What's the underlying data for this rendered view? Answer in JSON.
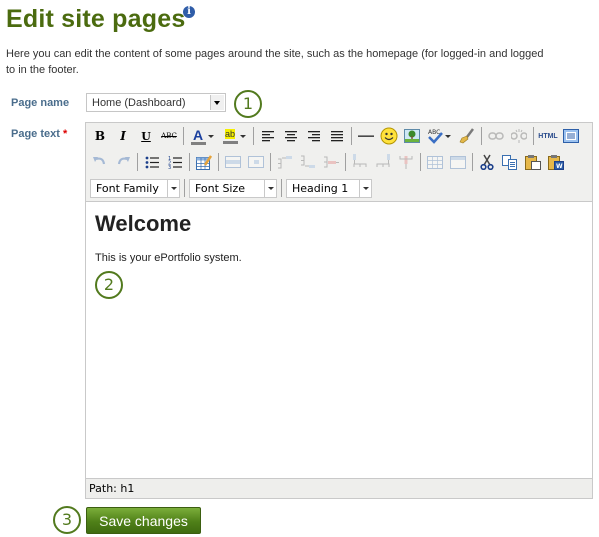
{
  "page": {
    "title": "Edit site pages",
    "info_icon": "info-icon",
    "description_line1": "Here you can edit the content of some pages around the site, such as the homepage (for logged-in and logged",
    "description_line2": "to in the footer."
  },
  "form": {
    "page_name_label": "Page name",
    "page_name_value": "Home (Dashboard)",
    "page_text_label": "Page text",
    "required_marker": "*",
    "save_label": "Save changes"
  },
  "editor": {
    "toolbar_row1": [
      "bold",
      "italic",
      "underline",
      "strikethrough",
      "text-color",
      "highlight-color",
      "align-left",
      "align-center",
      "align-right",
      "align-justify",
      "horizontal-rule",
      "emoticons",
      "image",
      "spellcheck",
      "cleanup",
      "link",
      "unlink",
      "html-source",
      "fullscreen"
    ],
    "toolbar_row2": [
      "undo",
      "redo",
      "bullet-list",
      "numbered-list",
      "table",
      "row-props",
      "cell-props",
      "insert-row-before",
      "insert-row-after",
      "delete-row",
      "insert-col-before",
      "insert-col-after",
      "delete-col",
      "split-cells",
      "merge-cells",
      "cut",
      "copy",
      "paste",
      "paste-word"
    ],
    "bold_glyph": "B",
    "italic_glyph": "I",
    "underline_glyph": "U",
    "strike_glyph": "ABC",
    "color_glyph": "A",
    "highlight_glyph": "ab",
    "html_glyph": "HTML",
    "font_family": "Font Family",
    "font_size": "Font Size",
    "format": "Heading 1",
    "content_heading": "Welcome",
    "content_paragraph": "This is your ePortfolio system.",
    "path": "Path: h1"
  },
  "callouts": [
    "1",
    "2",
    "3"
  ],
  "colors": {
    "title": "#4b6b0f",
    "label": "#4a6d8c",
    "callout": "#527a1e",
    "save_button": "#4f8018"
  }
}
